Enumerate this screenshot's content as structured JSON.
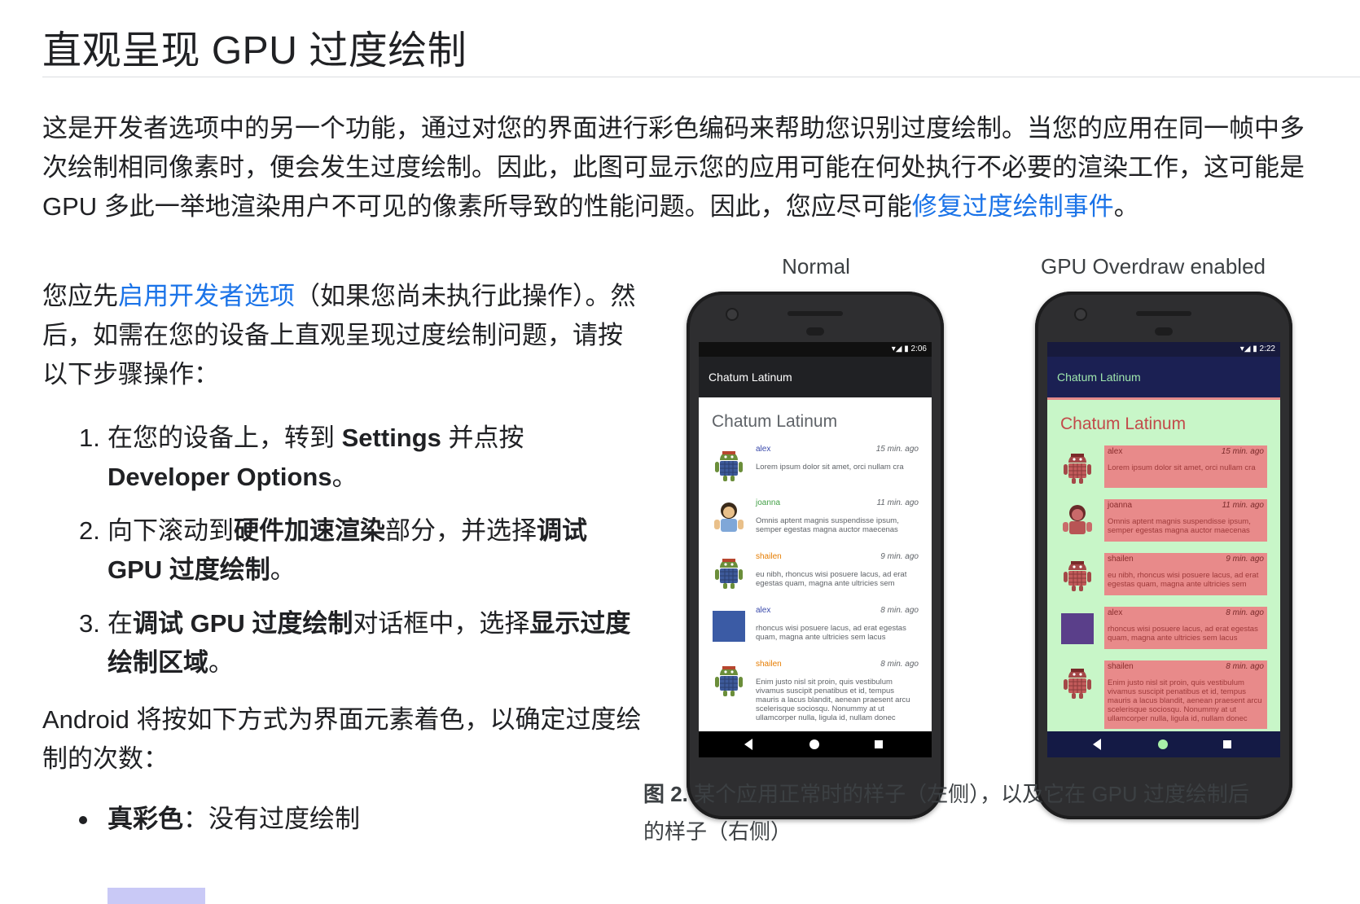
{
  "page": {
    "title": "直观呈现 GPU 过度绘制",
    "intro": {
      "before_link": "这是开发者选项中的另一个功能，通过对您的界面进行彩色编码来帮助您识别过度绘制。当您的应用在同一帧中多次绘制相同像素时，便会发生过度绘制。因此，此图可显示您的应用可能在何处执行不必要的渲染工作，这可能是 GPU 多此一举地渲染用户不可见的像素所导致的性能问题。因此，您应尽可能",
      "link": "修复过度绘制事件",
      "after_link": "。"
    },
    "enable": {
      "before_link": "您应先",
      "link": "启用开发者选项",
      "after_link": "（如果您尚未执行此操作）。然后，如需在您的设备上直观呈现过度绘制问题，请按以下步骤操作："
    },
    "steps": [
      {
        "num": "1.",
        "a": "在您的设备上，转到 ",
        "b": "Settings",
        "c": " 并点按 ",
        "d": "Developer Options",
        "e": "。"
      },
      {
        "num": "2.",
        "a": "向下滚动到",
        "b": "硬件加速渲染",
        "c": "部分，并选择",
        "d": "调试 GPU 过度绘制",
        "e": "。"
      },
      {
        "num": "3.",
        "a": "在",
        "b": "调试 GPU 过度绘制",
        "c": "对话框中，选择",
        "d": "显示过度绘制区域",
        "e": "。"
      }
    ],
    "colors_intro": "Android 将按如下方式为界面元素着色，以确定过度绘制的次数：",
    "bullets": [
      {
        "bold": "真彩色",
        "rest": "：没有过度绘制"
      }
    ]
  },
  "figure": {
    "label_normal": "Normal",
    "label_overdraw": "GPU Overdraw enabled",
    "normal": {
      "time": "2:06",
      "app_title": "Chatum Latinum",
      "content_title": "Chatum Latinum"
    },
    "overdraw": {
      "time": "2:22",
      "app_title": "Chatum Latinum",
      "content_title": "Chatum Latinum"
    },
    "messages": [
      {
        "user": "alex",
        "time": "15 min. ago",
        "text": "Lorem ipsum dolor sit amet, orci nullam cra",
        "color": "#3949ab",
        "avatar": "android"
      },
      {
        "user": "joanna",
        "time": "11 min. ago",
        "text": "Omnis aptent magnis suspendisse ipsum, semper egestas magna auctor maecenas",
        "color": "#43a047",
        "avatar": "girl"
      },
      {
        "user": "shailen",
        "time": "9 min. ago",
        "text": "eu nibh, rhoncus wisi posuere lacus, ad erat egestas quam, magna ante ultricies sem",
        "color": "#e67c00",
        "avatar": "android"
      },
      {
        "user": "alex",
        "time": "8 min. ago",
        "text": "rhoncus wisi posuere lacus, ad erat egestas quam, magna ante ultricies sem lacus",
        "color": "#3949ab",
        "avatar": "square"
      },
      {
        "user": "shailen",
        "time": "8 min. ago",
        "text": "Enim justo nisl sit proin, quis vestibulum vivamus suscipit penatibus et id, tempus mauris a lacus blandit, aenean praesent arcu scelerisque sociosqu. Nonummy at ut ullamcorper nulla, ligula id, nullam donec",
        "color": "#e67c00",
        "avatar": "android"
      }
    ],
    "caption_bold": "图 2.",
    "caption_text": " 某个应用正常时的样子（左侧），以及它在 GPU 过度绘制后的样子（右侧）"
  },
  "colors": {
    "link": "#1a73e8",
    "true_color_swatch": "#c9c9f6",
    "overdraw_1x": "#e88a8a",
    "overdraw_bg": "#c8f6c8"
  }
}
